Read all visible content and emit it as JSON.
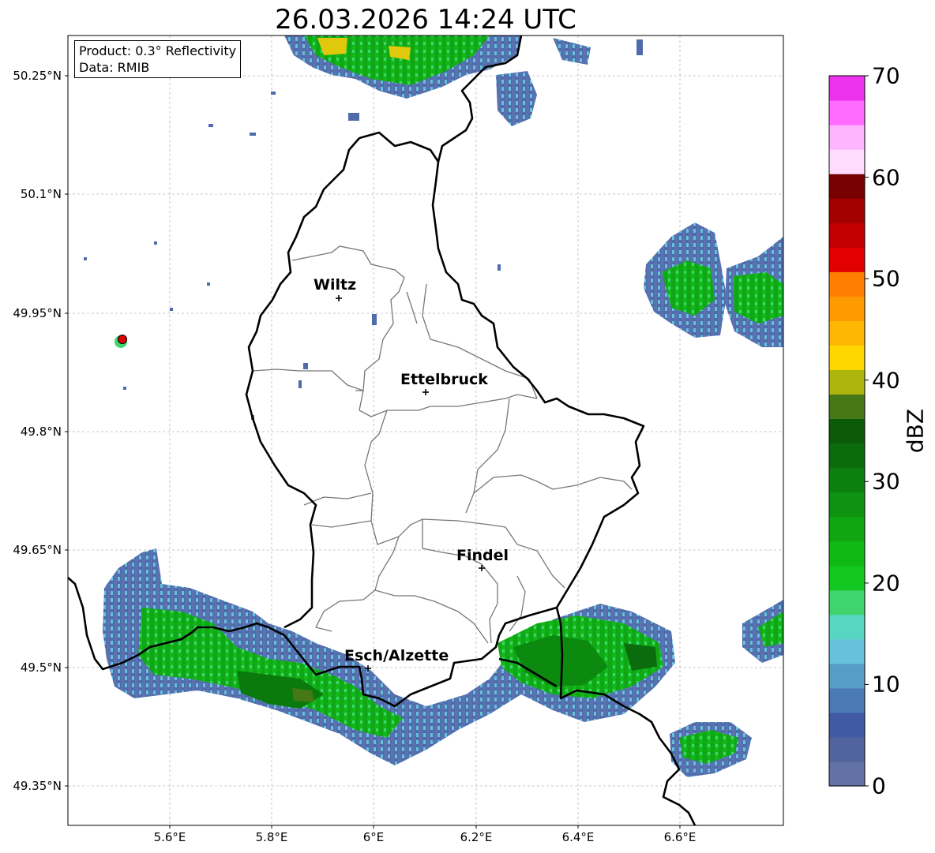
{
  "title": "26.03.2026 14:24 UTC",
  "info": {
    "product": "Product: 0.3° Reflectivity",
    "source": "Data: RMIB"
  },
  "axes": {
    "lat_ticks": [
      "50.25°N",
      "50.1°N",
      "49.95°N",
      "49.8°N",
      "49.65°N",
      "49.5°N",
      "49.35°N"
    ],
    "lon_ticks": [
      "5.6°E",
      "5.8°E",
      "6°E",
      "6.2°E",
      "6.4°E",
      "6.6°E"
    ]
  },
  "cities": [
    {
      "name": "Wiltz"
    },
    {
      "name": "Ettelbruck"
    },
    {
      "name": "Findel"
    },
    {
      "name": "Esch/Alzette"
    }
  ],
  "colorbar": {
    "label": "dBZ",
    "ticks": [
      "0",
      "10",
      "20",
      "30",
      "40",
      "50",
      "60",
      "70"
    ],
    "min": 0,
    "max": 70,
    "colors": [
      "#6372a6",
      "#52649d",
      "#415ba2",
      "#4a79b5",
      "#579ec7",
      "#67c0dc",
      "#58d5c3",
      "#3fd46e",
      "#12c71f",
      "#11b917",
      "#10a613",
      "#0e9310",
      "#0c7f0e",
      "#0b6c0c",
      "#0a5a0a",
      "#477817",
      "#adb40c",
      "#ffd700",
      "#ffb703",
      "#ff9b00",
      "#ff8000",
      "#e20000",
      "#c30000",
      "#a40000",
      "#770000",
      "#ffdcff",
      "#ffb4ff",
      "#ff6cff",
      "#ee33ee"
    ]
  },
  "colors": {
    "light_rain": "#4f6bab",
    "moderate_rain": "#12b81a",
    "heavy_rain": "#0a7a0c",
    "cell_core": "#ffd700",
    "radar_site": "#e00000",
    "border": "#000000",
    "canton_border": "#777777"
  }
}
